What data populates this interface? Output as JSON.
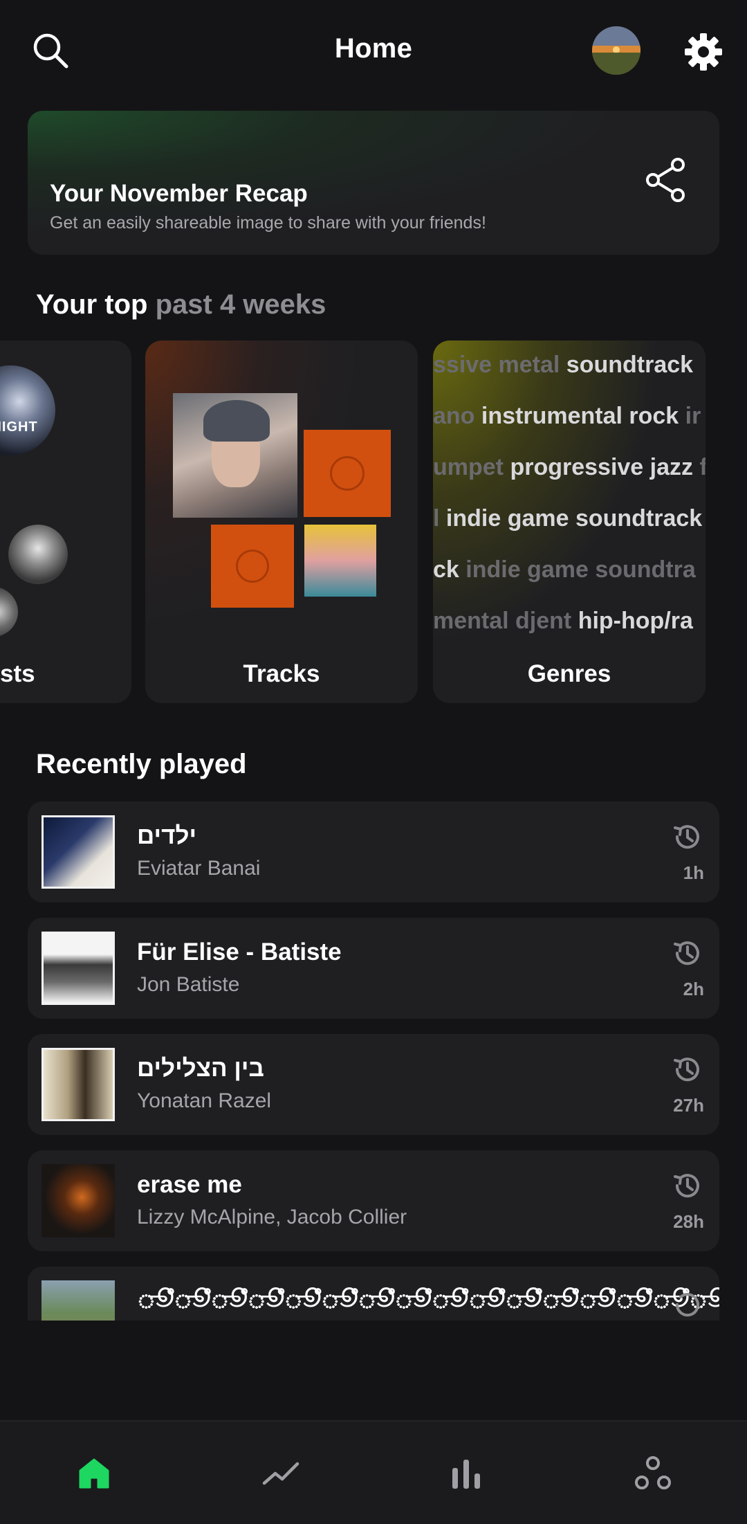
{
  "header": {
    "title": "Home"
  },
  "recap": {
    "title": "Your November Recap",
    "subtitle": "Get an easily shareable image to share with your friends!"
  },
  "top": {
    "title_main": "Your top",
    "title_period": "past 4 weeks",
    "cards": [
      {
        "label": "Artists",
        "visible_label": "sts"
      },
      {
        "label": "Tracks"
      },
      {
        "label": "Genres"
      }
    ],
    "artist_art_text": "KNIGHT",
    "genres_rows": [
      [
        {
          "t": "ssive metal",
          "dim": true
        },
        {
          "t": "soundtrack",
          "dim": false
        }
      ],
      [
        {
          "t": "ano",
          "dim": true
        },
        {
          "t": "instrumental rock",
          "dim": false
        },
        {
          "t": "ir",
          "dim": true
        }
      ],
      [
        {
          "t": "umpet",
          "dim": true
        },
        {
          "t": "progressive jazz",
          "dim": false
        },
        {
          "t": "f",
          "dim": true
        }
      ],
      [
        {
          "t": "l",
          "dim": true
        },
        {
          "t": "indie game soundtrack",
          "dim": false
        }
      ],
      [
        {
          "t": "ck",
          "dim": false
        },
        {
          "t": "indie game soundtra",
          "dim": true
        }
      ],
      [
        {
          "t": "mental djent",
          "dim": true
        },
        {
          "t": "hip-hop/ra",
          "dim": false
        }
      ]
    ]
  },
  "recent": {
    "title": "Recently played",
    "items": [
      {
        "song": "ילדים",
        "artist": "Eviatar Banai",
        "ago": "1h"
      },
      {
        "song": "Für Elise - Batiste",
        "artist": "Jon Batiste",
        "ago": "2h"
      },
      {
        "song": "בין הצלילים",
        "artist": "Yonatan Razel",
        "ago": "27h"
      },
      {
        "song": "erase me",
        "artist": "Lizzy McAlpine, Jacob Collier",
        "ago": "28h"
      },
      {
        "song": "ூஂூஂூஂூஂூஂூஂூஂூஂூஂூஂூஂூஂூஂூஂூஂூஂூஂூஂூஂூஂூஂூஂூஂ",
        "artist": "",
        "ago": ""
      }
    ]
  },
  "colors": {
    "accent": "#1ed760",
    "background": "#141416",
    "card": "#1f1f22"
  },
  "icons": {
    "header": [
      "search-icon",
      "avatar",
      "gear-icon"
    ],
    "recap": "share-icon",
    "recent": "history-icon",
    "nav": [
      "home-icon",
      "trend-icon",
      "bar-chart-icon",
      "people-icon"
    ]
  }
}
